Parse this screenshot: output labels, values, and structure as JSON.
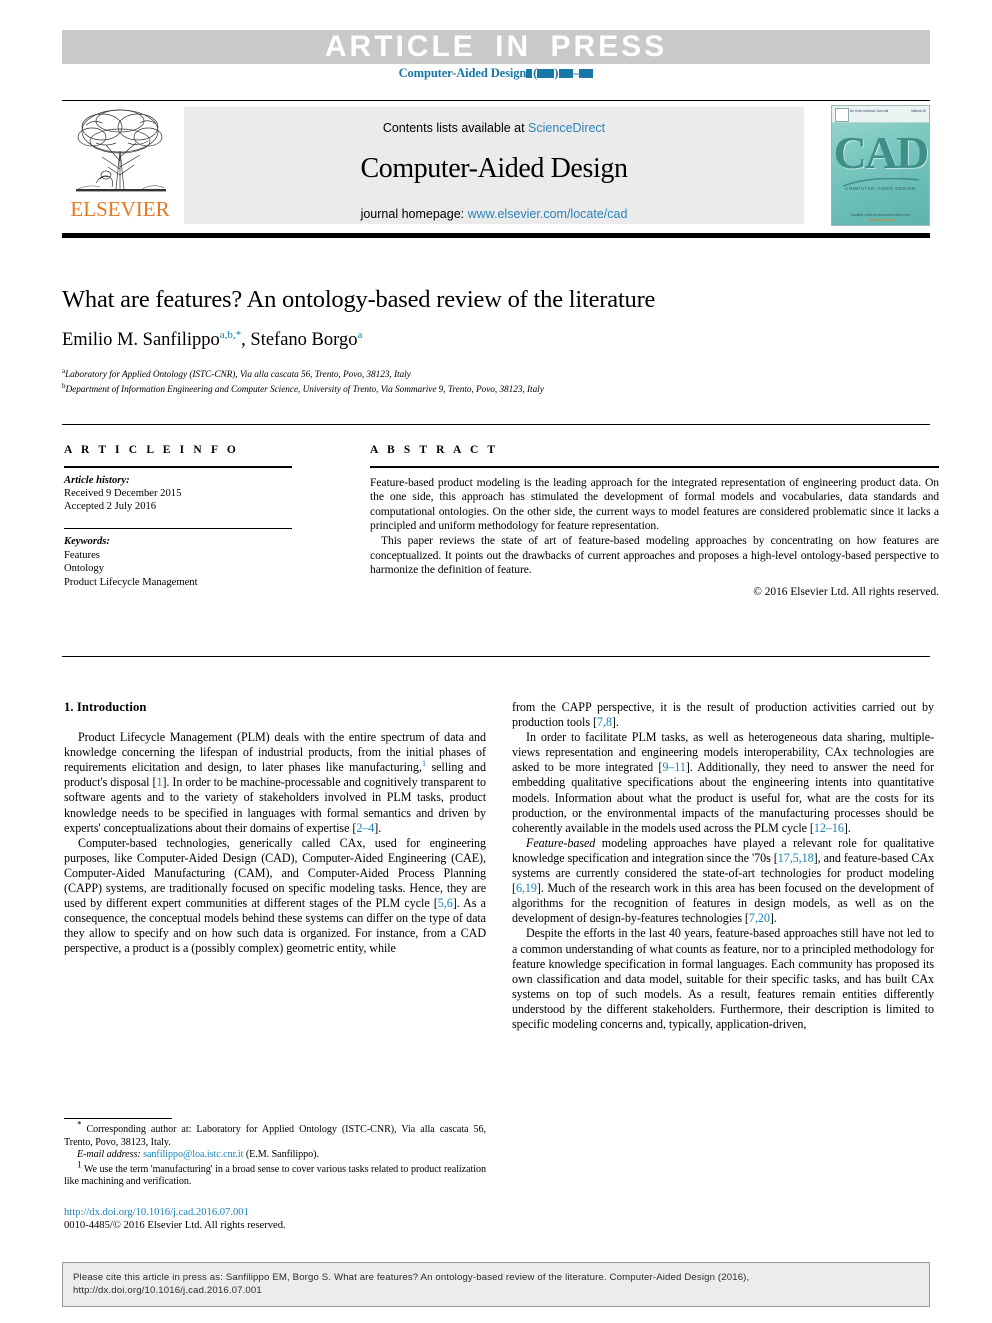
{
  "banner": {
    "article_in_press": "ARTICLE IN PRESS",
    "journal_ref_prefix": "Computer-Aided Design"
  },
  "masthead": {
    "contents_prefix": "Contents lists available at ",
    "contents_link": "ScienceDirect",
    "journal_title": "Computer-Aided Design",
    "homepage_prefix": "journal homepage: ",
    "homepage_url": "www.elsevier.com/locate/cad",
    "publisher_wordmark": "ELSEVIER",
    "cover": {
      "big_text": "CAD",
      "subtitle": "COMPUTER-AIDED DESIGN",
      "top_left": "An International Journal",
      "top_right": "Volume 00",
      "footer": "Available online at www.sciencedirect.com",
      "footer_logo": "ScienceDirect"
    }
  },
  "article": {
    "title": "What are features? An ontology-based review of the literature",
    "authors": [
      {
        "name": "Emilio M. Sanfilippo",
        "sup": "a,b,*"
      },
      {
        "name": "Stefano Borgo",
        "sup": "a"
      }
    ],
    "affiliations": [
      {
        "mark": "a",
        "text": "Laboratory for Applied Ontology (ISTC-CNR), Via alla cascata 56, Trento, Povo, 38123, Italy"
      },
      {
        "mark": "b",
        "text": "Department of Information Engineering and Computer Science, University of Trento, Via Sommarive 9, Trento, Povo, 38123, Italy"
      }
    ]
  },
  "info": {
    "heading": "A R T I C L E   I N F O",
    "history_label": "Article history:",
    "history": [
      "Received 9 December 2015",
      "Accepted 2 July 2016"
    ],
    "keywords_label": "Keywords:",
    "keywords": [
      "Features",
      "Ontology",
      "Product Lifecycle Management"
    ]
  },
  "abstract": {
    "heading": "A B S T R A C T",
    "paragraphs": [
      "Feature-based product modeling is the leading approach for the integrated representation of engineering product data. On the one side, this approach has stimulated the development of formal models and vocabularies, data standards and computational ontologies. On the other side, the current ways to model features are considered problematic since it lacks a principled and uniform methodology for feature representation.",
      "This paper reviews the state of art of feature-based modeling approaches by concentrating on how features are conceptualized. It points out the drawbacks of current approaches and proposes a high-level ontology-based perspective to harmonize the definition of feature."
    ],
    "copyright": "© 2016 Elsevier Ltd. All rights reserved."
  },
  "body": {
    "section_number_title": "1. Introduction",
    "left_paragraphs": [
      "Product Lifecycle Management (PLM) deals with the entire spectrum of data and knowledge concerning the lifespan of industrial products, from the initial phases of requirements elicitation and design, to later phases like manufacturing,[fn1] selling and product's disposal [1]. In order to be machine-processable and cognitively transparent to software agents and to the variety of stakeholders involved in PLM tasks, product knowledge needs to be specified in languages with formal semantics and driven by experts' conceptualizations about their domains of expertise [2–4].",
      "Computer-based technologies, generically called CAx, used for engineering purposes, like Computer-Aided Design (CAD), Computer-Aided Engineering (CAE), Computer-Aided Manufacturing (CAM), and Computer-Aided Process Planning (CAPP) systems, are traditionally focused on specific modeling tasks. Hence, they are used by different expert communities at different stages of the PLM cycle [5,6]. As a consequence, the conceptual models behind these systems can differ on the type of data they allow to specify and on how such data is organized. For instance, from a CAD perspective, a product is a (possibly complex) geometric entity, while"
    ],
    "right_paragraphs": [
      "from the CAPP perspective, it is the result of production activities carried out by production tools [7,8].",
      "In order to facilitate PLM tasks, as well as heterogeneous data sharing, multiple-views representation and engineering models interoperability, CAx technologies are asked to be more integrated [9–11]. Additionally, they need to answer the need for embedding qualitative specifications about the engineering intents into quantitative models. Information about what the product is useful for, what are the costs for its production, or the environmental impacts of the manufacturing processes should be coherently available in the models used across the PLM cycle [12–16].",
      "Feature-based modeling approaches have played a relevant role for qualitative knowledge specification and integration since the '70s [17,5,18], and feature-based CAx systems are currently considered the state-of-art technologies for product modeling [6,19]. Much of the research work in this area has been focused on the development of algorithms for the recognition of features in design models, as well as on the development of design-by-features technologies [7,20].",
      "Despite the efforts in the last 40 years, feature-based approaches still have not led to a common understanding of what counts as feature, nor to a principled methodology for feature knowledge specification in formal languages. Each community has proposed its own classification and data model, suitable for their specific tasks, and has built CAx systems on top of such models. As a result, features remain entities differently understood by the different stakeholders. Furthermore, their description is limited to specific modeling concerns and, typically, application-driven,"
    ]
  },
  "footnotes": {
    "corresponding_mark": "*",
    "corresponding_text": "Corresponding author at: Laboratory for Applied Ontology (ISTC-CNR), Via alla cascata 56, Trento, Povo, 38123, Italy.",
    "email_label": "E-mail address:",
    "email": "sanfilippo@loa.istc.cnr.it",
    "email_suffix": "(E.M. Sanfilippo).",
    "note1_mark": "1",
    "note1_text": "We use the term 'manufacturing' in a broad sense to cover various tasks related to product realization like machining and verification."
  },
  "doi": {
    "url": "http://dx.doi.org/10.1016/j.cad.2016.07.001",
    "issn_line": "0010-4485/© 2016 Elsevier Ltd. All rights reserved."
  },
  "cite_box": {
    "line1": "Please cite this article in press as: Sanfilippo EM, Borgo S. What are features? An ontology-based review of the literature. Computer-Aided Design (2016),",
    "line2": "http://dx.doi.org/10.1016/j.cad.2016.07.001"
  },
  "colors": {
    "link": "#1b82b8",
    "banner_bg": "#c9c9c9",
    "masthead_panel": "#ebebeb",
    "elsevier_orange": "#e87722",
    "cover_teal": "#5fb3ac"
  }
}
